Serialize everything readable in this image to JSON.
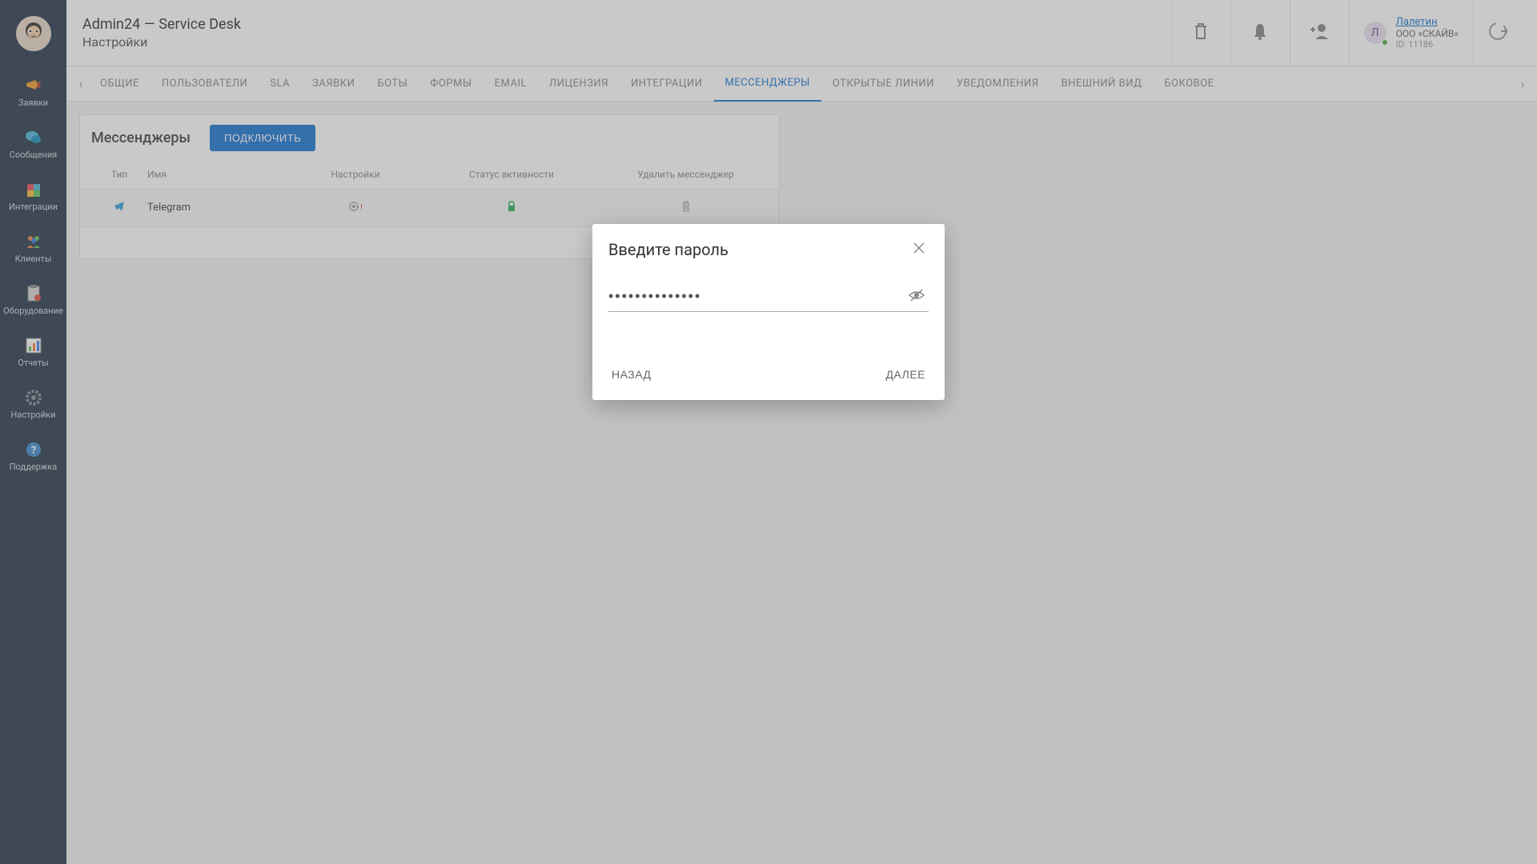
{
  "sidebar": {
    "items": [
      {
        "label": "Заявки"
      },
      {
        "label": "Сообщения"
      },
      {
        "label": "Интеграции"
      },
      {
        "label": "Клиенты"
      },
      {
        "label": "Оборудование"
      },
      {
        "label": "Отчеты"
      },
      {
        "label": "Настройки"
      },
      {
        "label": "Поддержка"
      }
    ]
  },
  "topbar": {
    "title": "Admin24 — Service Desk",
    "subtitle": "Настройки",
    "user": {
      "initial": "Л",
      "name": "Лалетин",
      "company": "ООО «СКАЙВ»",
      "id_label": "ID: 11186"
    }
  },
  "tabs": [
    "ОБЩИЕ",
    "ПОЛЬЗОВАТЕЛИ",
    "SLA",
    "ЗАЯВКИ",
    "БОТЫ",
    "ФОРМЫ",
    "EMAIL",
    "ЛИЦЕНЗИЯ",
    "ИНТЕГРАЦИИ",
    "МЕССЕНДЖЕРЫ",
    "ОТКРЫТЫЕ ЛИНИИ",
    "УВЕДОМЛЕНИЯ",
    "ВНЕШНИЙ ВИД",
    "БОКОВОЕ"
  ],
  "active_tab_index": 9,
  "panel": {
    "title": "Мессенджеры",
    "connect_btn": "ПОДКЛЮЧИТЬ",
    "headers": {
      "type": "Тип",
      "name": "Имя",
      "settings": "Настройки",
      "status": "Статус активности",
      "delete": "Удалить мессенджер"
    },
    "rows": [
      {
        "name": "Telegram"
      }
    ]
  },
  "modal": {
    "title": "Введите пароль",
    "password_value": "••••••••••••••",
    "back_btn": "НАЗАД",
    "next_btn": "ДАЛЕЕ"
  }
}
